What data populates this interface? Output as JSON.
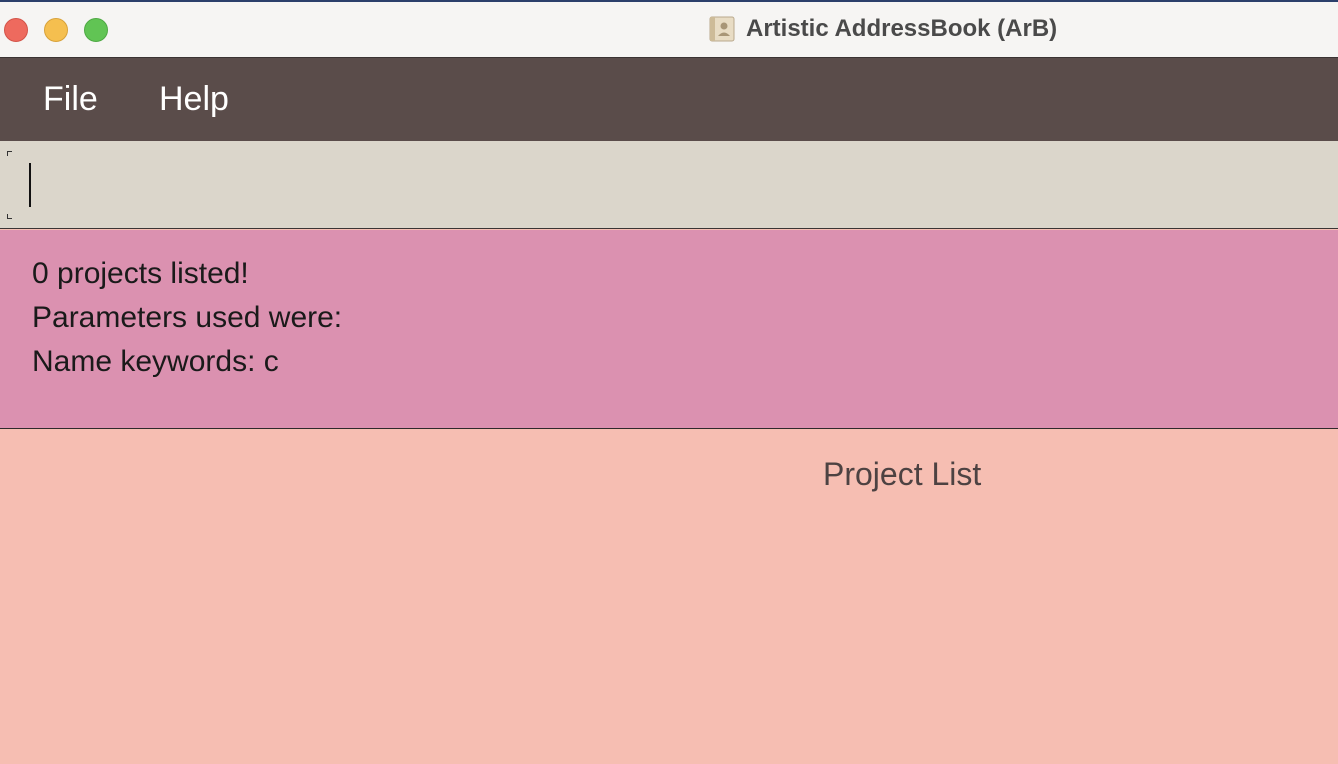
{
  "window": {
    "title": "Artistic AddressBook (ArB)",
    "app_icon": "address-book-icon"
  },
  "menu": {
    "items": [
      {
        "label": "File"
      },
      {
        "label": "Help"
      }
    ]
  },
  "command_box": {
    "value": "",
    "placeholder": ""
  },
  "result": {
    "lines": [
      "0 projects listed!",
      "Parameters used were:",
      "Name keywords: c"
    ]
  },
  "project_list": {
    "title": "Project List",
    "items": []
  },
  "colors": {
    "menubar": "#5a4c4a",
    "commandbox": "#dbd6cb",
    "resultbox": "#db91b0",
    "listpanel": "#f6beb2",
    "traffic_close": "#ee6a5e",
    "traffic_minimize": "#f5bf4f",
    "traffic_zoom": "#61c454"
  }
}
